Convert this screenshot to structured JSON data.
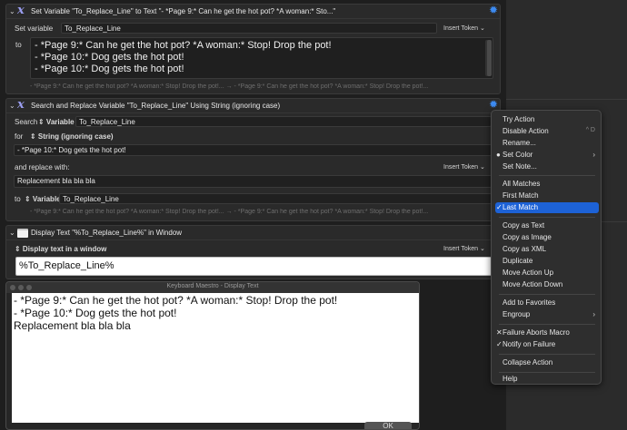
{
  "block1": {
    "title": "Set Variable \"To_Replace_Line\" to Text \"- *Page 9:* Can he get the hot pot? *A woman:* Sto...\"",
    "set_variable_label": "Set variable",
    "variable_value": "To_Replace_Line",
    "insert_token": "Insert Token ⌄",
    "to_label": "to",
    "text_lines": [
      "- *Page 9:* Can he get the hot pot? *A woman:* Stop! Drop the pot!",
      "- *Page 10:* Dog gets the hot pot!",
      "- *Page 10:* Dog gets the hot pot!"
    ],
    "preview": "- *Page 9:* Can he get the hot pot? *A woman:* Stop! Drop the pot!... → - *Page 9:* Can he get the hot pot? *A woman:* Stop! Drop the pot!..."
  },
  "block2": {
    "title": "Search and Replace Variable \"To_Replace_Line\" Using String (ignoring case)",
    "search_label": "Search",
    "search_type": "⇕ Variable",
    "search_value": "To_Replace_Line",
    "for_label": "for",
    "for_type": "⇕ String (ignoring case)",
    "for_value": "- *Page 10:* Dog gets the hot pot!",
    "replace_label": "and replace with:",
    "insert_token": "Insert Token ⌄",
    "replace_value": "Replacement bla bla bla",
    "to_label": "to",
    "to_type": "⇕ Variable",
    "to_value": "To_Replace_Line",
    "preview": "- *Page 9:* Can he get the hot pot? *A woman:* Stop! Drop the pot!... → - *Page 9:* Can he get the hot pot? *A woman:* Stop! Drop the pot!..."
  },
  "block3": {
    "title": "Display Text \"%To_Replace_Line%\" in Window",
    "mode_label": "⇕ Display text in a window",
    "insert_token": "Insert Token ⌄",
    "text_value": "%To_Replace_Line%"
  },
  "display_window": {
    "title": "Keyboard Maestro - Display Text",
    "lines": [
      "- *Page 9:* Can he get the hot pot? *A woman:* Stop! Drop the pot!",
      "- *Page 10:* Dog gets the hot pot!",
      "Replacement bla bla bla"
    ],
    "ok_label": "OK"
  },
  "context_menu": {
    "items": [
      {
        "label": "Try Action"
      },
      {
        "label": "Disable Action",
        "shortcut": "^ D"
      },
      {
        "label": "Rename..."
      },
      {
        "label": "Set Color",
        "mark": "●",
        "submenu": true
      },
      {
        "label": "Set Note..."
      },
      {
        "label": "All Matches"
      },
      {
        "label": "First Match"
      },
      {
        "label": "Last Match",
        "mark": "✓",
        "highlighted": true
      },
      {
        "label": "Copy as Text"
      },
      {
        "label": "Copy as Image"
      },
      {
        "label": "Copy as XML"
      },
      {
        "label": "Duplicate"
      },
      {
        "label": "Move Action Up"
      },
      {
        "label": "Move Action Down"
      },
      {
        "label": "Add to Favorites"
      },
      {
        "label": "Engroup",
        "submenu": true
      },
      {
        "label": "Failure Aborts Macro",
        "mark": "✕"
      },
      {
        "label": "Notify on Failure",
        "mark": "✓"
      },
      {
        "label": "Collapse Action"
      },
      {
        "label": "Help"
      }
    ]
  },
  "colors": {
    "accent": "#1d62d6",
    "gear": "#3d8bf2",
    "variable_icon": "#9b9ef0"
  },
  "icons": {
    "action_icon": "x-variable-icon",
    "window_icon": "window-icon",
    "gear": "gear-icon"
  }
}
